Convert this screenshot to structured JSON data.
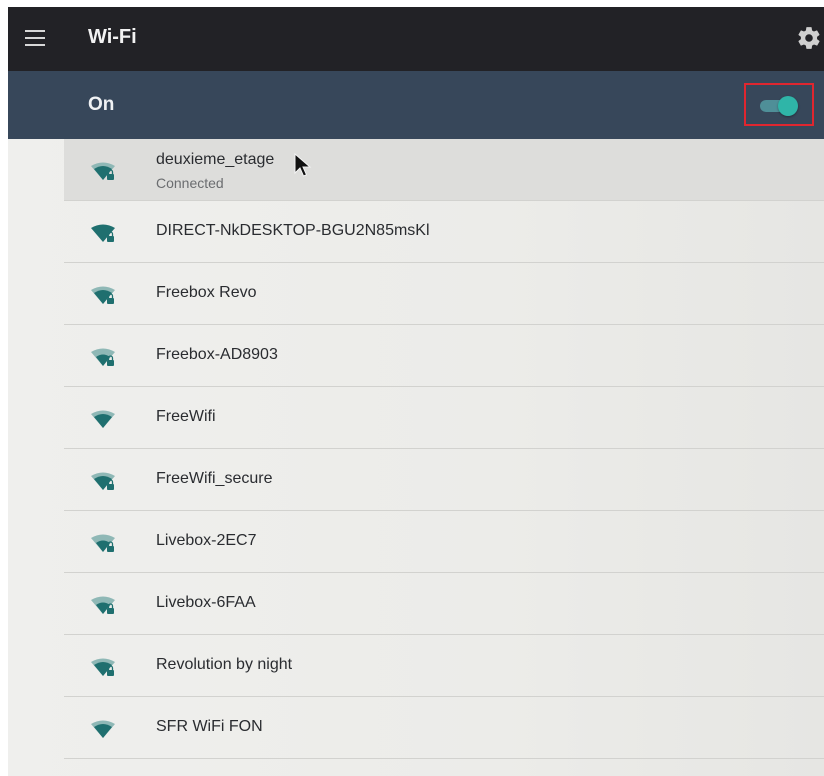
{
  "appbar": {
    "title": "Wi-Fi",
    "menu_icon": "menu-icon",
    "settings_icon": "gear-icon"
  },
  "toggle": {
    "label": "On",
    "state": "on",
    "accent": "#2fb5a8",
    "highlight_color": "#e0262f"
  },
  "networks": [
    {
      "ssid": "deuxieme_etage",
      "status": "Connected",
      "locked": true
    },
    {
      "ssid": "DIRECT-NkDESKTOP-BGU2N85msKl",
      "status": "",
      "locked": true
    },
    {
      "ssid": "Freebox Revo",
      "status": "",
      "locked": true
    },
    {
      "ssid": "Freebox-AD8903",
      "status": "",
      "locked": true
    },
    {
      "ssid": "FreeWifi",
      "status": "",
      "locked": false
    },
    {
      "ssid": "FreeWifi_secure",
      "status": "",
      "locked": true
    },
    {
      "ssid": "Livebox-2EC7",
      "status": "",
      "locked": true
    },
    {
      "ssid": "Livebox-6FAA",
      "status": "",
      "locked": true
    },
    {
      "ssid": "Revolution by night",
      "status": "",
      "locked": true
    },
    {
      "ssid": "SFR WiFi FON",
      "status": "",
      "locked": false
    }
  ],
  "colors": {
    "appbar": "#222226",
    "toggle_bar": "#37475a",
    "wifi_icon": "#1f6f6f"
  }
}
